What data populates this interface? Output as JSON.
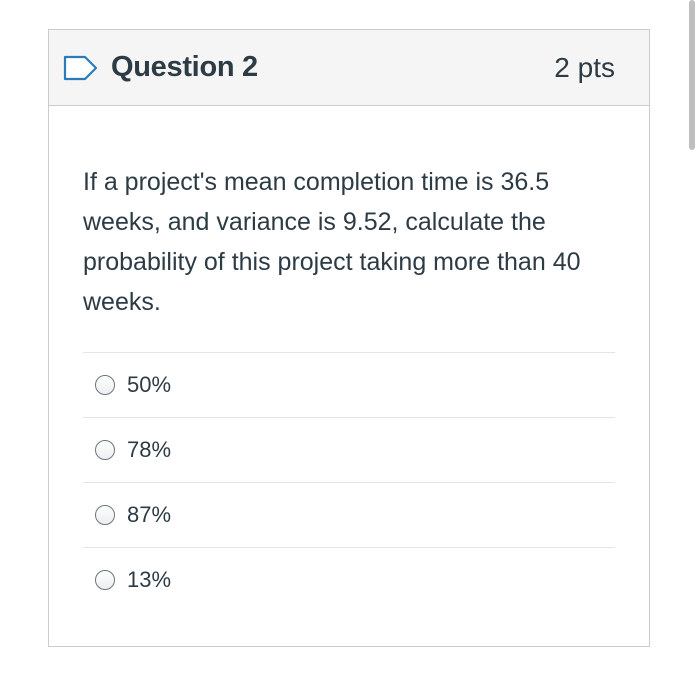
{
  "question": {
    "title": "Question 2",
    "points": "2 pts",
    "text": "If a project's mean completion time is 36.5 weeks, and variance is 9.52, calculate the probability of this project taking more than 40 weeks.",
    "flag_icon": "flag-outline-icon"
  },
  "answers": [
    {
      "label": "50%",
      "selected": false
    },
    {
      "label": "78%",
      "selected": false
    },
    {
      "label": "87%",
      "selected": false
    },
    {
      "label": "13%",
      "selected": false
    }
  ],
  "colors": {
    "header_bg": "#f5f5f5",
    "border": "#c7cdd1",
    "text": "#2d3b45",
    "flag": "#2b7abc"
  }
}
